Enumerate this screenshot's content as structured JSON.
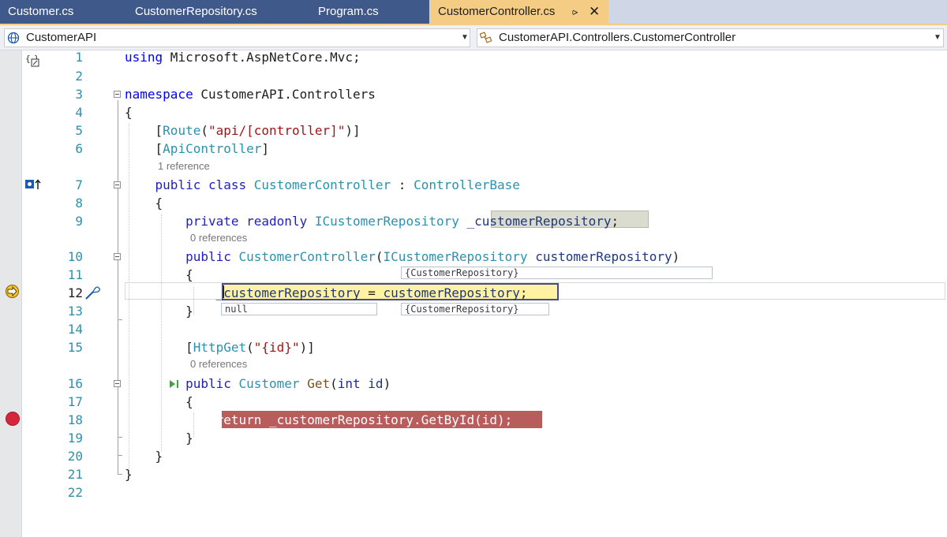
{
  "tabs": [
    {
      "label": "Customer.cs",
      "active": false
    },
    {
      "label": "CustomerRepository.cs",
      "active": false
    },
    {
      "label": "Program.cs",
      "active": false
    },
    {
      "label": "CustomerController.cs",
      "active": true
    }
  ],
  "tab_icons": {
    "pin": "pin-icon",
    "close": "close-icon"
  },
  "nav": {
    "project": "CustomerAPI",
    "scope": "CustomerAPI.Controllers.CustomerController"
  },
  "lines": [
    {
      "n": "1",
      "text": "using Microsoft.AspNetCore.Mvc;"
    },
    {
      "n": "2",
      "text": ""
    },
    {
      "n": "3",
      "text": "namespace CustomerAPI.Controllers"
    },
    {
      "n": "4",
      "text": "{"
    },
    {
      "n": "5",
      "text": "    [Route(\"api/[controller]\")]"
    },
    {
      "n": "6",
      "text": "    [ApiController]"
    },
    {
      "n": "7",
      "text": "    public class CustomerController : ControllerBase"
    },
    {
      "n": "8",
      "text": "    {"
    },
    {
      "n": "9",
      "text": "        private readonly ICustomerRepository _customerRepository;"
    },
    {
      "n": "10",
      "text": "        public CustomerController(ICustomerRepository customerRepository)"
    },
    {
      "n": "11",
      "text": "        {"
    },
    {
      "n": "12",
      "text": "            _customerRepository = customerRepository;"
    },
    {
      "n": "13",
      "text": "        }"
    },
    {
      "n": "14",
      "text": ""
    },
    {
      "n": "15",
      "text": "        [HttpGet(\"{id}\")]"
    },
    {
      "n": "16",
      "text": "        public Customer Get(int id)"
    },
    {
      "n": "17",
      "text": "        {"
    },
    {
      "n": "18",
      "text": "            return _customerRepository.GetById(id);"
    },
    {
      "n": "19",
      "text": "        }"
    },
    {
      "n": "20",
      "text": "    }"
    },
    {
      "n": "21",
      "text": "}"
    },
    {
      "n": "22",
      "text": ""
    }
  ],
  "codelens": {
    "class_refs": "1 reference",
    "field_refs": "0 references",
    "get_refs": "0 references"
  },
  "hints": {
    "line11": "{CustomerRepository}",
    "null_value": "null",
    "line13": "{CustomerRepository}"
  },
  "debug": {
    "current_line": "12",
    "breakpoint_line": "18"
  },
  "colors": {
    "active_tab": "#f5cc84",
    "inactive_tab": "#3f5a8a",
    "breakpoint": "#d6263b",
    "breakpoint_highlight": "#b85c5c",
    "current_statement": "#fff3a3"
  }
}
